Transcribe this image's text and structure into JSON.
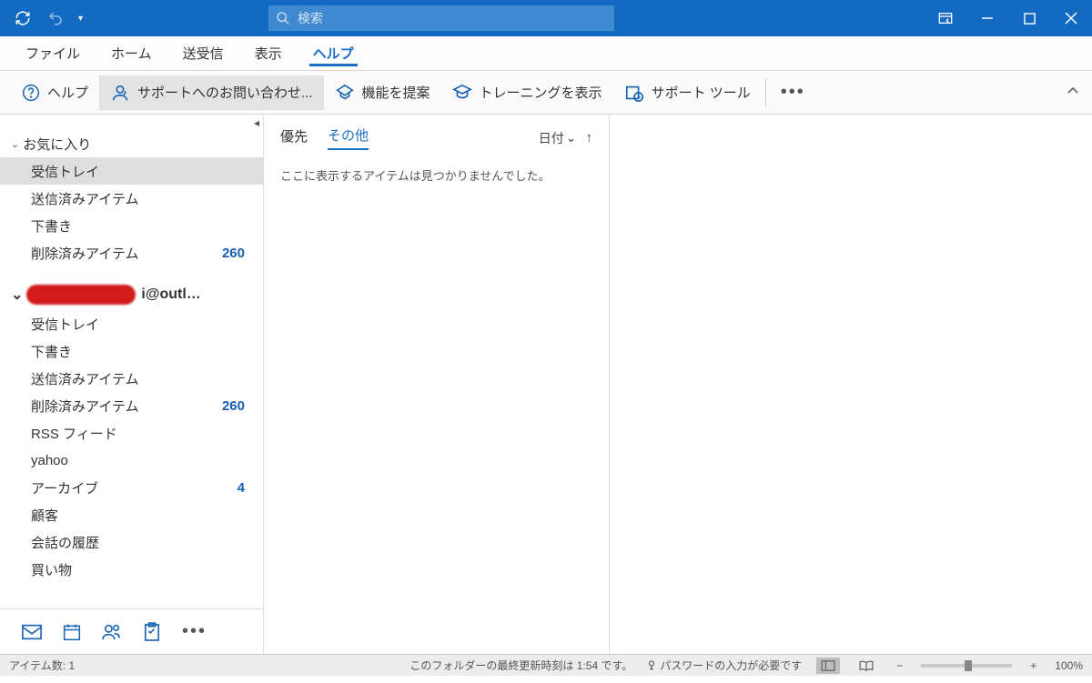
{
  "titlebar": {
    "search_placeholder": "検索"
  },
  "menu": {
    "file": "ファイル",
    "home": "ホーム",
    "sendreceive": "送受信",
    "view": "表示",
    "help": "ヘルプ"
  },
  "ribbon": {
    "help": "ヘルプ",
    "contact_support": "サポートへのお問い合わせ...",
    "suggest_feature": "機能を提案",
    "show_training": "トレーニングを表示",
    "support_tools": "サポート ツール"
  },
  "sidebar": {
    "favorites_header": "お気に入り",
    "fav_items": [
      {
        "label": "受信トレイ",
        "count": "",
        "selected": true
      },
      {
        "label": "送信済みアイテム",
        "count": ""
      },
      {
        "label": "下書き",
        "count": ""
      },
      {
        "label": "削除済みアイテム",
        "count": "260"
      }
    ],
    "account_suffix": "i@outl…",
    "acct_items": [
      {
        "label": "受信トレイ",
        "count": ""
      },
      {
        "label": "下書き",
        "count": ""
      },
      {
        "label": "送信済みアイテム",
        "count": ""
      },
      {
        "label": "削除済みアイテム",
        "count": "260"
      },
      {
        "label": "RSS フィード",
        "count": ""
      },
      {
        "label": "yahoo",
        "count": ""
      },
      {
        "label": "アーカイブ",
        "count": "4"
      },
      {
        "label": "顧客",
        "count": ""
      },
      {
        "label": "会話の履歴",
        "count": ""
      },
      {
        "label": "買い物",
        "count": ""
      }
    ]
  },
  "listpane": {
    "tab_focused": "優先",
    "tab_other": "その他",
    "sort_label": "日付",
    "empty": "ここに表示するアイテムは見つかりませんでした。"
  },
  "statusbar": {
    "item_count": "アイテム数: 1",
    "last_update": "このフォルダーの最終更新時刻は 1:54 です。",
    "password_needed": "パスワードの入力が必要です",
    "zoom": "100%"
  }
}
